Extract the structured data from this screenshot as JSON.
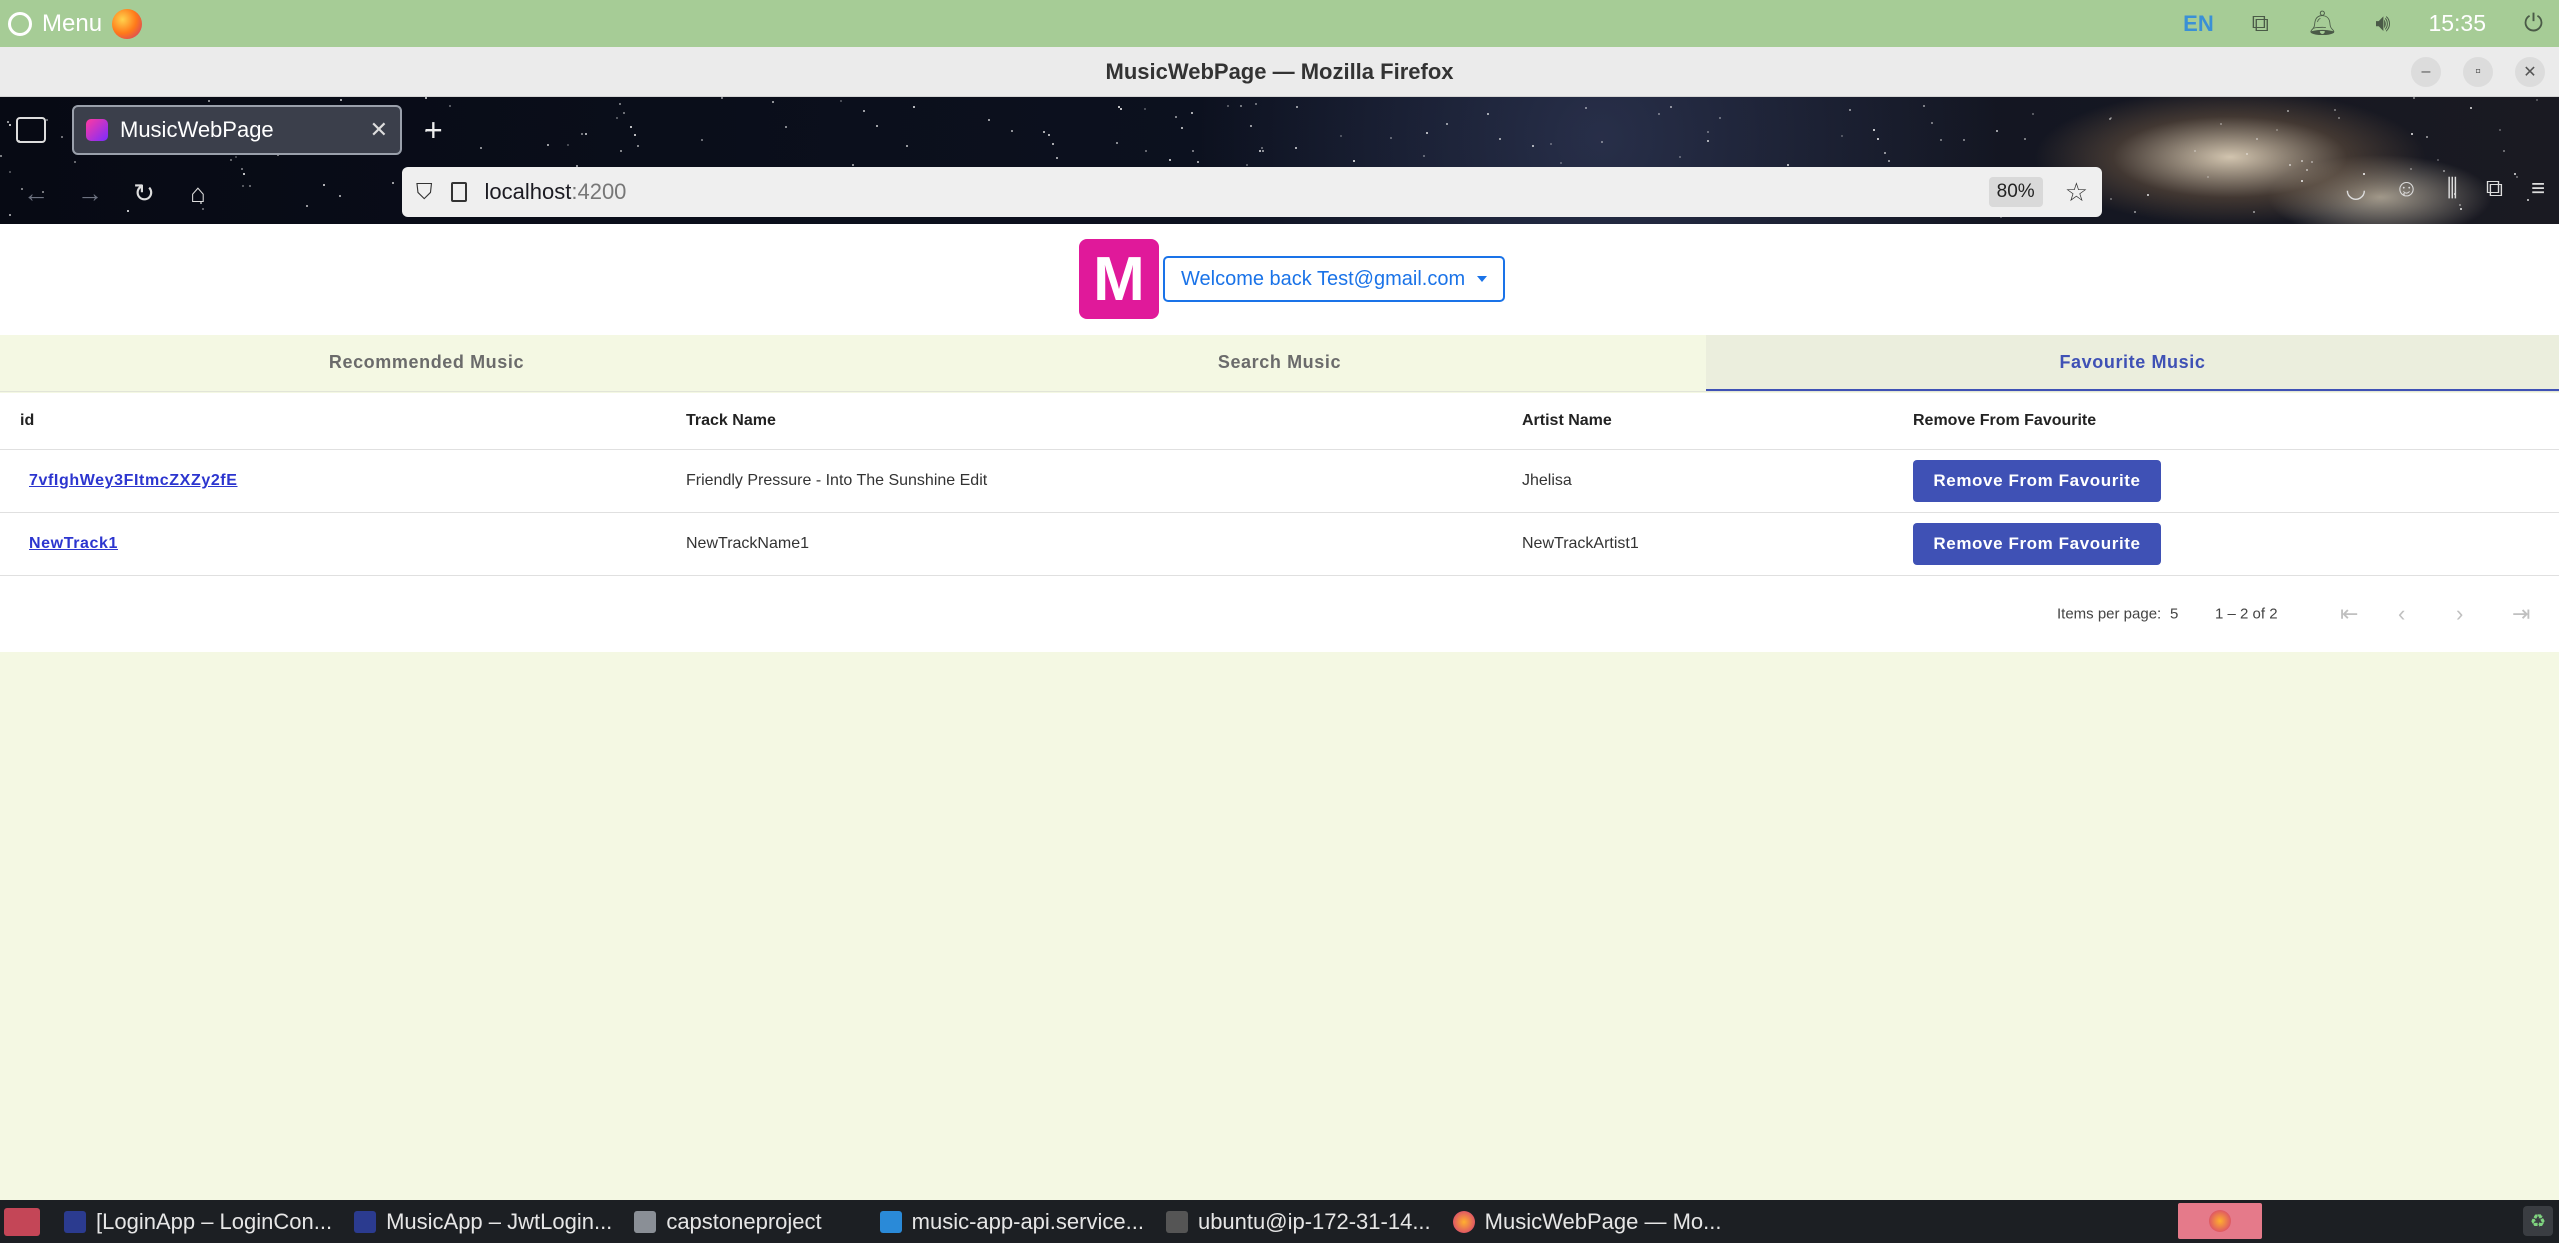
{
  "os_panel": {
    "menu_label": "Menu",
    "lang": "EN",
    "time": "15:35",
    "icons": [
      "network-icon",
      "notification-icon",
      "volume-icon",
      "power-icon"
    ]
  },
  "window": {
    "title": "MusicWebPage — Mozilla Firefox"
  },
  "browser": {
    "tab_title": "MusicWebPage",
    "url_host": "localhost",
    "url_port": ":4200",
    "zoom": "80%"
  },
  "app": {
    "logo_letter": "M",
    "logo_color": "#e0199a",
    "accent_color": "#3f51b5",
    "welcome_text": "Welcome back Test@gmail.com",
    "tabs": [
      {
        "label": "Recommended Music",
        "active": false
      },
      {
        "label": "Search Music",
        "active": false
      },
      {
        "label": "Favourite Music",
        "active": true
      }
    ],
    "table": {
      "headers": [
        "id",
        "Track Name",
        "Artist Name",
        "Remove From Favourite"
      ],
      "rows": [
        {
          "id": "7vfIghWey3FItmcZXZy2fE",
          "track": "Friendly Pressure - Into The Sunshine Edit",
          "artist": "Jhelisa",
          "action": "Remove From Favourite"
        },
        {
          "id": "NewTrack1",
          "track": "NewTrackName1",
          "artist": "NewTrackArtist1",
          "action": "Remove From Favourite"
        }
      ]
    },
    "paginator": {
      "items_per_page_label": "Items per page:",
      "items_per_page": "5",
      "range": "1 – 2 of 2"
    }
  },
  "taskbar": {
    "items": [
      "[LoginApp – LoginCon...",
      "MusicApp – JwtLogin...",
      "capstoneproject",
      "music-app-api.service...",
      "ubuntu@ip-172-31-14...",
      "MusicWebPage — Mo..."
    ]
  }
}
